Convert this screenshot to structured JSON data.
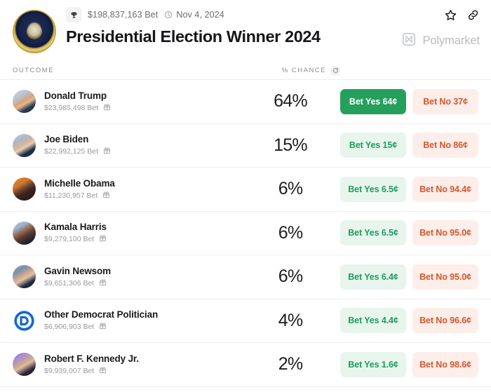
{
  "header": {
    "seal_icon": "presidential-seal",
    "trophy_icon": "trophy-icon",
    "volume": "$198,837,163 Bet",
    "clock_icon": "clock-icon",
    "date": "Nov 4, 2024",
    "title": "Presidential Election Winner 2024",
    "star_icon": "star-icon",
    "link_icon": "link-icon",
    "brand": "Polymarket",
    "brand_icon": "polymarket-logo"
  },
  "table": {
    "col_outcome": "OUTCOME",
    "col_chance": "% CHANCE",
    "refresh_icon": "refresh-icon",
    "gift_icon": "gift-icon",
    "rows": [
      {
        "name": "Donald Trump",
        "volume": "$23,985,498 Bet",
        "chance": "64%",
        "yes_label": "Bet Yes 64¢",
        "no_label": "Bet No 37¢",
        "yes_active": true,
        "avatar": "av-trump"
      },
      {
        "name": "Joe Biden",
        "volume": "$22,992,125 Bet",
        "chance": "15%",
        "yes_label": "Bet Yes 15¢",
        "no_label": "Bet No 86¢",
        "yes_active": false,
        "avatar": "av-biden"
      },
      {
        "name": "Michelle Obama",
        "volume": "$11,230,957 Bet",
        "chance": "6%",
        "yes_label": "Bet Yes 6.5¢",
        "no_label": "Bet No 94.4¢",
        "yes_active": false,
        "avatar": "av-obama"
      },
      {
        "name": "Kamala Harris",
        "volume": "$9,279,100 Bet",
        "chance": "6%",
        "yes_label": "Bet Yes 6.5¢",
        "no_label": "Bet No 95.0¢",
        "yes_active": false,
        "avatar": "av-harris"
      },
      {
        "name": "Gavin Newsom",
        "volume": "$9,651,306 Bet",
        "chance": "6%",
        "yes_label": "Bet Yes 6.4¢",
        "no_label": "Bet No 95.0¢",
        "yes_active": false,
        "avatar": "av-newsom"
      },
      {
        "name": "Other Democrat Politician",
        "volume": "$6,906,903 Bet",
        "chance": "4%",
        "yes_label": "Bet Yes 4.4¢",
        "no_label": "Bet No 96.6¢",
        "yes_active": false,
        "avatar": "av-dem"
      },
      {
        "name": "Robert F. Kennedy Jr.",
        "volume": "$9,939,007 Bet",
        "chance": "2%",
        "yes_label": "Bet Yes 1.6¢",
        "no_label": "Bet No 98.6¢",
        "yes_active": false,
        "avatar": "av-rfk"
      }
    ]
  },
  "colors": {
    "yes_green": "#25a05c",
    "yes_bg": "#e7f5ec",
    "no_red": "#d7552c",
    "no_bg": "#fdeeea",
    "dem_blue": "#1567d3"
  }
}
